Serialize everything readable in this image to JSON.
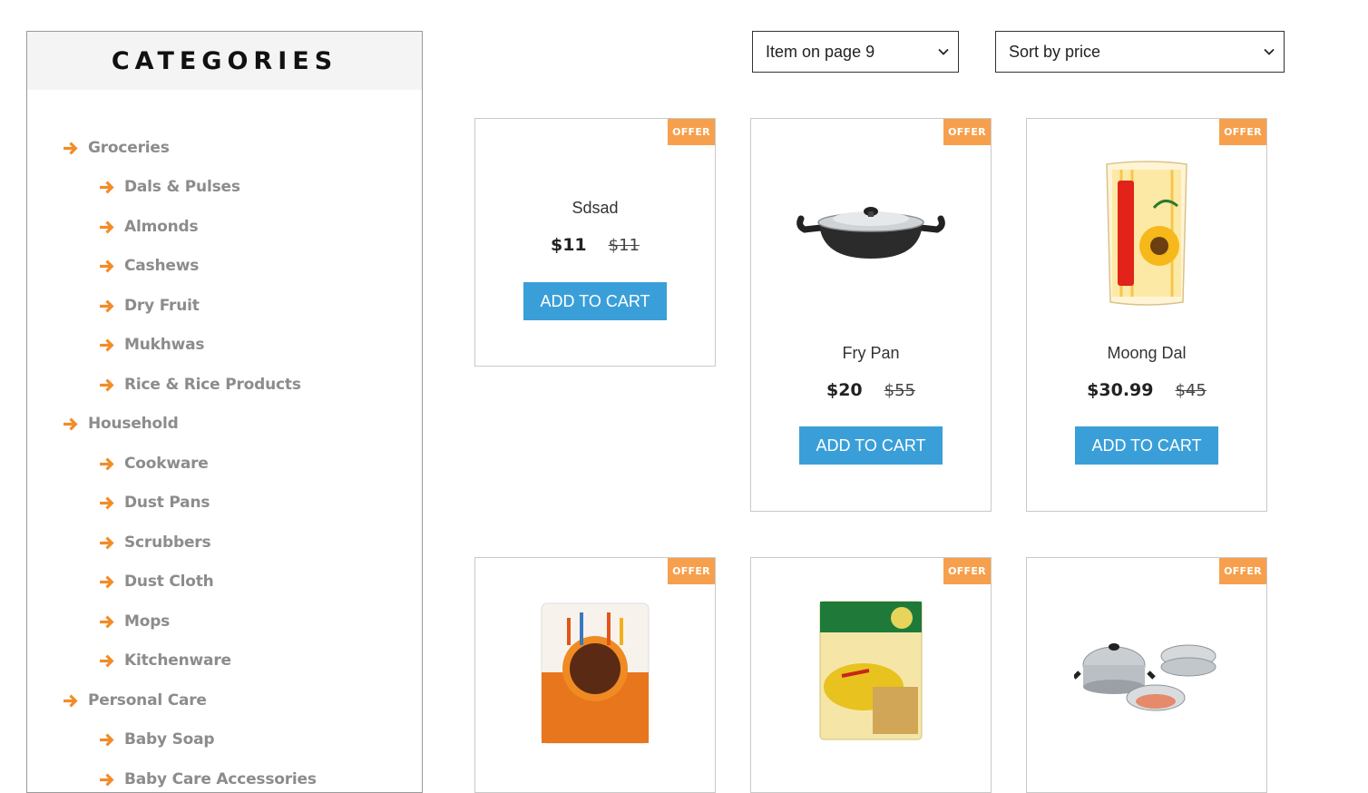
{
  "sidebar": {
    "title": "CATEGORIES",
    "items": [
      {
        "label": "Groceries"
      },
      {
        "label": "Dals & Pulses"
      },
      {
        "label": "Almonds"
      },
      {
        "label": "Cashews"
      },
      {
        "label": "Dry Fruit"
      },
      {
        "label": "Mukhwas"
      },
      {
        "label": "Rice & Rice Products"
      },
      {
        "label": "Household"
      },
      {
        "label": "Cookware"
      },
      {
        "label": "Dust Pans"
      },
      {
        "label": "Scrubbers"
      },
      {
        "label": "Dust Cloth"
      },
      {
        "label": "Mops"
      },
      {
        "label": "Kitchenware"
      },
      {
        "label": "Personal Care"
      },
      {
        "label": "Baby Soap"
      },
      {
        "label": "Baby Care Accessories"
      }
    ]
  },
  "toolbar": {
    "items_per_page": "Item on page 9",
    "sort": "Sort by price"
  },
  "products": [
    {
      "name": "Sdsad",
      "price": "$11",
      "old_price": "$11",
      "badge": "OFFER",
      "button": "ADD TO CART"
    },
    {
      "name": "Fry Pan",
      "price": "$20",
      "old_price": "$55",
      "badge": "OFFER",
      "button": "ADD TO CART"
    },
    {
      "name": "Moong Dal",
      "price": "$30.99",
      "old_price": "$45",
      "badge": "OFFER",
      "button": "ADD TO CART"
    },
    {
      "badge": "OFFER"
    },
    {
      "badge": "OFFER"
    },
    {
      "badge": "OFFER"
    }
  ],
  "colors": {
    "accent": "#f28c28",
    "button": "#3a9fd8",
    "offer": "#f6a04d"
  }
}
